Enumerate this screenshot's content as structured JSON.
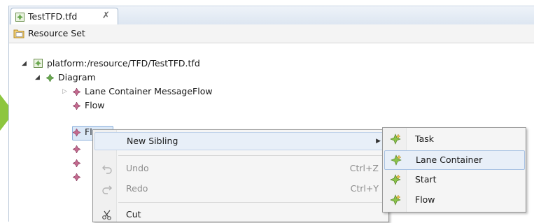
{
  "editor": {
    "tab_title": "TestTFD.tfd",
    "tab_close_glyph": "✗",
    "resource_set_label": "Resource Set"
  },
  "tree": {
    "resource": "platform:/resource/TFD/TestTFD.tfd",
    "diagram": "Diagram",
    "items": [
      {
        "label": "Lane Container MessageFlow",
        "expandable": true
      },
      {
        "label": "Flow",
        "expandable": false
      },
      {
        "label": "Fl",
        "expandable": false,
        "selected": true
      },
      {
        "label": "",
        "expandable": false
      },
      {
        "label": "",
        "expandable": false
      },
      {
        "label": "",
        "expandable": false
      }
    ]
  },
  "context_menu": {
    "items": [
      {
        "label": "New Sibling",
        "submenu": true,
        "highlighted": true
      },
      {
        "label": "Undo",
        "accelerator": "Ctrl+Z",
        "enabled": false,
        "icon": "undo-icon"
      },
      {
        "label": "Redo",
        "accelerator": "Ctrl+Y",
        "enabled": false,
        "icon": "redo-icon"
      },
      {
        "label": "Cut",
        "icon": "cut-icon"
      }
    ]
  },
  "submenu": {
    "items": [
      {
        "label": "Task"
      },
      {
        "label": "Lane Container",
        "highlighted": true
      },
      {
        "label": "Start"
      },
      {
        "label": "Flow"
      }
    ]
  },
  "colors": {
    "arrow": "#8dc63f",
    "selection": "#dbe8f7",
    "menu_highlight": "#e8eff8",
    "diamond_green": "#6fb03f",
    "diamond_pink": "#c05a8a"
  }
}
